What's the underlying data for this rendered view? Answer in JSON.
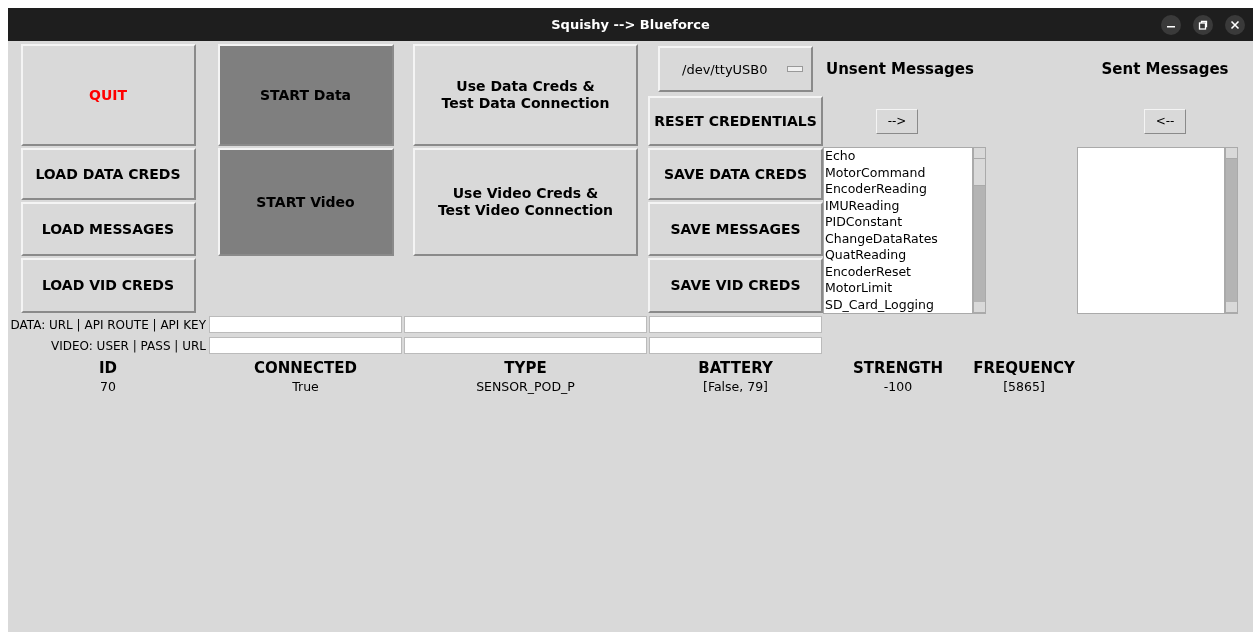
{
  "window": {
    "title": "Squishy --> Blueforce"
  },
  "column_1": [
    {
      "label": "QUIT",
      "kind": "danger"
    },
    {
      "label": "LOAD DATA CREDS",
      "kind": "normal"
    },
    {
      "label": "LOAD MESSAGES",
      "kind": "normal"
    },
    {
      "label": "LOAD VID CREDS",
      "kind": "normal"
    }
  ],
  "column_2": [
    {
      "label": "START Data",
      "kind": "dark"
    },
    {
      "label": "START Video",
      "kind": "dark"
    }
  ],
  "column_3": [
    {
      "label": "Use Data Creds &\nTest Data Connection",
      "kind": "normal"
    },
    {
      "label": "Use Video Creds &\nTest Video Connection",
      "kind": "normal"
    }
  ],
  "port_select": {
    "value": "/dev/ttyUSB0"
  },
  "column_4": [
    {
      "label": "RESET CREDENTIALS",
      "kind": "normal"
    },
    {
      "label": "SAVE DATA CREDS",
      "kind": "normal"
    },
    {
      "label": "SAVE MESSAGES",
      "kind": "normal"
    },
    {
      "label": "SAVE VID CREDS",
      "kind": "normal"
    }
  ],
  "unsent": {
    "title": "Unsent Messages",
    "button": "-->",
    "items": [
      "Echo",
      "MotorCommand",
      "EncoderReading",
      "IMUReading",
      "PIDConstant",
      "ChangeDataRates",
      "QuatReading",
      "EncoderReset",
      "MotorLimit",
      "SD_Card_Logging"
    ]
  },
  "sent": {
    "title": "Sent Messages",
    "button": "<--"
  },
  "credentials": [
    {
      "label": "DATA: URL | API ROUTE | API KEY"
    },
    {
      "label": "VIDEO: USER | PASS | URL"
    }
  ],
  "table": {
    "columns": [
      "ID",
      "CONNECTED",
      "TYPE",
      "BATTERY",
      "STRENGTH",
      "FREQUENCY"
    ],
    "rows": [
      [
        "70",
        "True",
        "SENSOR_POD_P",
        "[False, 79]",
        "-100",
        "[5865]"
      ]
    ]
  }
}
